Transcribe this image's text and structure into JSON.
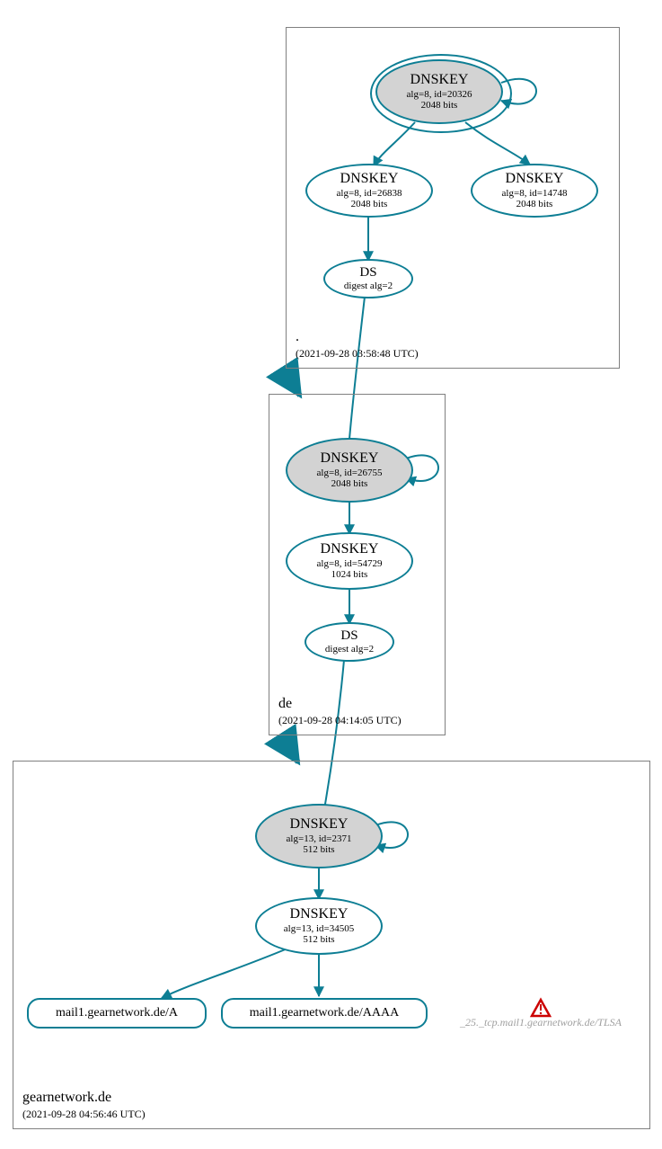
{
  "zones": {
    "root": {
      "name": ".",
      "time": "(2021-09-28 03:58:48 UTC)"
    },
    "de": {
      "name": "de",
      "time": "(2021-09-28 04:14:05 UTC)"
    },
    "gear": {
      "name": "gearnetwork.de",
      "time": "(2021-09-28 04:56:46 UTC)"
    }
  },
  "nodes": {
    "root_ksk": {
      "title": "DNSKEY",
      "l1": "alg=8, id=20326",
      "l2": "2048 bits"
    },
    "root_zsk1": {
      "title": "DNSKEY",
      "l1": "alg=8, id=26838",
      "l2": "2048 bits"
    },
    "root_zsk2": {
      "title": "DNSKEY",
      "l1": "alg=8, id=14748",
      "l2": "2048 bits"
    },
    "root_ds": {
      "title": "DS",
      "l1": "digest alg=2"
    },
    "de_ksk": {
      "title": "DNSKEY",
      "l1": "alg=8, id=26755",
      "l2": "2048 bits"
    },
    "de_zsk": {
      "title": "DNSKEY",
      "l1": "alg=8, id=54729",
      "l2": "1024 bits"
    },
    "de_ds": {
      "title": "DS",
      "l1": "digest alg=2"
    },
    "gear_ksk": {
      "title": "DNSKEY",
      "l1": "alg=13, id=2371",
      "l2": "512 bits"
    },
    "gear_zsk": {
      "title": "DNSKEY",
      "l1": "alg=13, id=34505",
      "l2": "512 bits"
    },
    "rr_a": {
      "label": "mail1.gearnetwork.de/A"
    },
    "rr_aaaa": {
      "label": "mail1.gearnetwork.de/AAAA"
    },
    "rr_tlsa": {
      "label": "_25._tcp.mail1.gearnetwork.de/TLSA"
    }
  },
  "colors": {
    "stroke": "#0d7e94",
    "zone_border": "#808080"
  }
}
